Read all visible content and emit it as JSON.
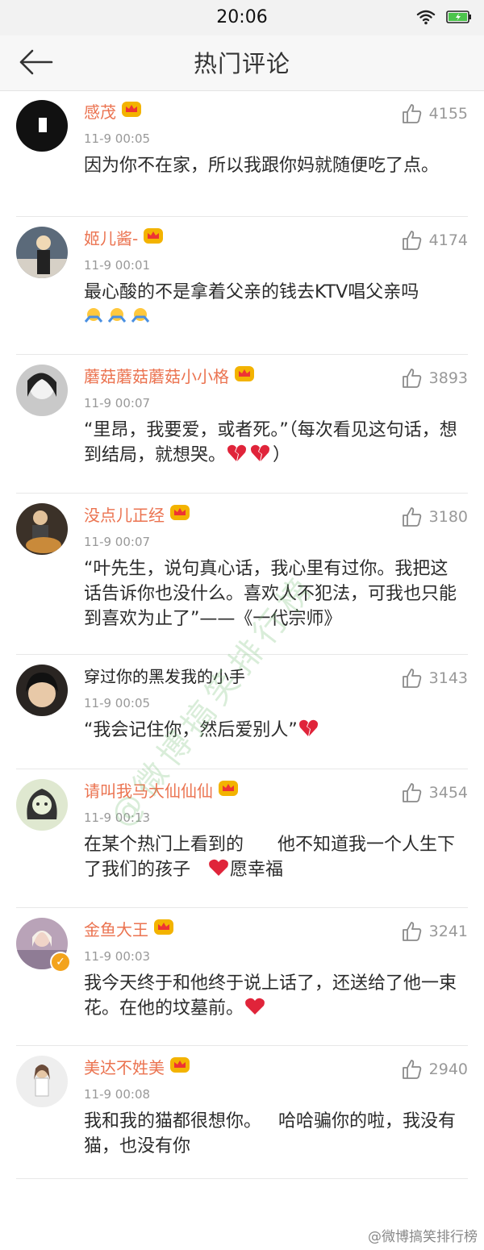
{
  "status_bar": {
    "time": "20:06"
  },
  "header": {
    "title": "热门评论"
  },
  "comments": [
    {
      "user": "感茂",
      "time": "11-9 00:05",
      "likes": "4155",
      "text": "因为你不在家，所以我跟你妈就随便吃了点。",
      "avatar_bg": "#111111"
    },
    {
      "user": "姬儿酱-",
      "time": "11-9 00:01",
      "likes": "4174",
      "text": "最心酸的不是拿着父亲的钱去KTV唱父亲吗",
      "avatar_bg": "#5b6a7a"
    },
    {
      "user": "蘑菇蘑菇蘑菇小小格",
      "time": "11-9 00:07",
      "likes": "3893",
      "text": "“里昂，我要爱，或者死。”（每次看见这句话，想到结局，就想哭。",
      "text_end": "）",
      "avatar_bg": "#c9c9c9"
    },
    {
      "user": "没点儿正经",
      "time": "11-9 00:07",
      "likes": "3180",
      "text": "“叶先生，说句真心话，我心里有过你。我把这话告诉你也没什么。喜欢人不犯法，可我也只能到喜欢为止了”——《一代宗师》",
      "avatar_bg": "#3b3128"
    },
    {
      "user": "穿过你的黑发我的小手",
      "time": "11-9 00:05",
      "likes": "3143",
      "text": "“我会记住你，然后爱别人”",
      "avatar_bg": "#2a2522"
    },
    {
      "user": "请叫我马大仙仙仙",
      "time": "11-9 00:13",
      "likes": "3454",
      "text": "在某个热门上看到的      他不知道我一个人生下了我们的孩子   ",
      "text_end": "愿幸福",
      "avatar_bg": "#dfe8d0"
    },
    {
      "user": "金鱼大王",
      "time": "11-9 00:03",
      "likes": "3241",
      "text": "我今天终于和他终于说上话了，还送给了他一束花。在他的坟墓前。",
      "avatar_bg": "#b9a3b8"
    },
    {
      "user": "美达不姓美",
      "time": "11-9 00:08",
      "likes": "2940",
      "text": "我和我的猫都很想你。   哈哈骗你的啦，我没有猫，也没有你",
      "avatar_bg": "#eeeeee"
    }
  ],
  "watermark": {
    "diagonal": "@微博搞笑排行榜",
    "corner": "@微博搞笑排行榜"
  },
  "colors": {
    "username": "#eb7350",
    "meta": "#999999",
    "vip_gold": "#f3b300"
  }
}
